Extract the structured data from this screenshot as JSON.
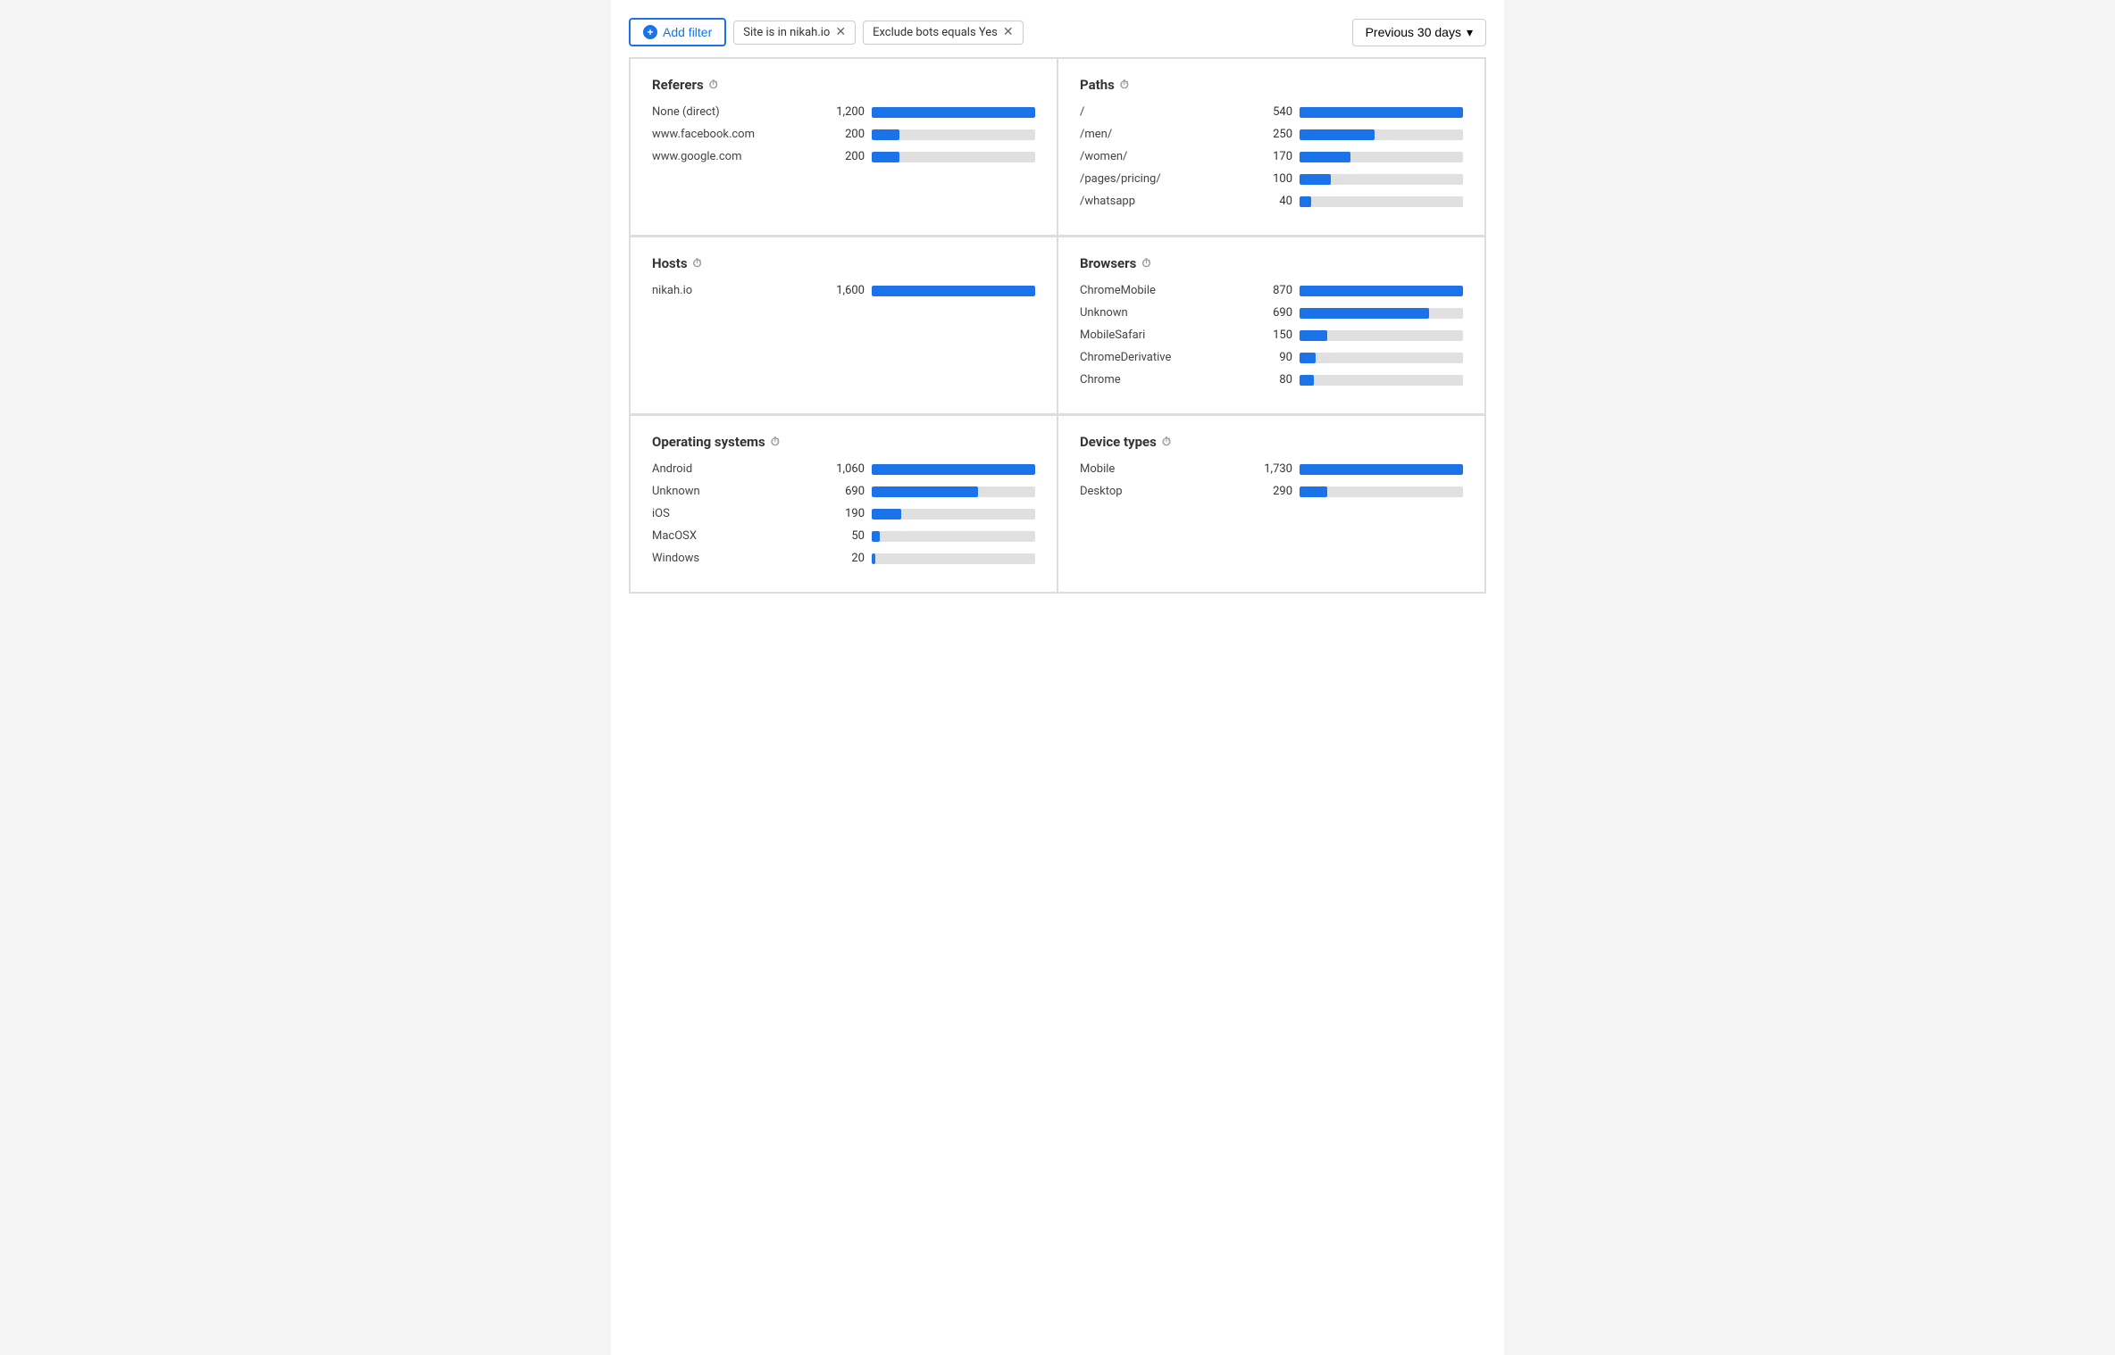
{
  "toolbar": {
    "add_filter_label": "Add filter",
    "date_label": "Previous 30 days"
  },
  "filters": [
    {
      "id": "filter-site",
      "text": "Site is in nikah.io"
    },
    {
      "id": "filter-bots",
      "text": "Exclude bots equals Yes"
    }
  ],
  "panels": [
    {
      "id": "referers",
      "title": "Referers",
      "col": 0,
      "row": 0,
      "max": 1200,
      "rows": [
        {
          "label": "None (direct)",
          "value": "1,200",
          "raw": 1200
        },
        {
          "label": "www.facebook.com",
          "value": "200",
          "raw": 200
        },
        {
          "label": "www.google.com",
          "value": "200",
          "raw": 200
        }
      ]
    },
    {
      "id": "paths",
      "title": "Paths",
      "col": 1,
      "row": 0,
      "max": 540,
      "rows": [
        {
          "label": "/",
          "value": "540",
          "raw": 540
        },
        {
          "label": "/men/",
          "value": "250",
          "raw": 250
        },
        {
          "label": "/women/",
          "value": "170",
          "raw": 170
        },
        {
          "label": "/pages/pricing/",
          "value": "100",
          "raw": 100
        },
        {
          "label": "/whatsapp",
          "value": "40",
          "raw": 40
        }
      ]
    },
    {
      "id": "hosts",
      "title": "Hosts",
      "col": 0,
      "row": 1,
      "max": 1600,
      "rows": [
        {
          "label": "nikah.io",
          "value": "1,600",
          "raw": 1600
        }
      ]
    },
    {
      "id": "browsers",
      "title": "Browsers",
      "col": 1,
      "row": 1,
      "max": 870,
      "rows": [
        {
          "label": "ChromeMobile",
          "value": "870",
          "raw": 870
        },
        {
          "label": "Unknown",
          "value": "690",
          "raw": 690
        },
        {
          "label": "MobileSafari",
          "value": "150",
          "raw": 150
        },
        {
          "label": "ChromeDerivative",
          "value": "90",
          "raw": 90
        },
        {
          "label": "Chrome",
          "value": "80",
          "raw": 80
        }
      ]
    },
    {
      "id": "operating-systems",
      "title": "Operating systems",
      "col": 0,
      "row": 2,
      "max": 1060,
      "rows": [
        {
          "label": "Android",
          "value": "1,060",
          "raw": 1060
        },
        {
          "label": "Unknown",
          "value": "690",
          "raw": 690
        },
        {
          "label": "iOS",
          "value": "190",
          "raw": 190
        },
        {
          "label": "MacOSX",
          "value": "50",
          "raw": 50
        },
        {
          "label": "Windows",
          "value": "20",
          "raw": 20
        }
      ]
    },
    {
      "id": "device-types",
      "title": "Device types",
      "col": 1,
      "row": 2,
      "max": 1730,
      "rows": [
        {
          "label": "Mobile",
          "value": "1,730",
          "raw": 1730
        },
        {
          "label": "Desktop",
          "value": "290",
          "raw": 290
        }
      ]
    }
  ]
}
